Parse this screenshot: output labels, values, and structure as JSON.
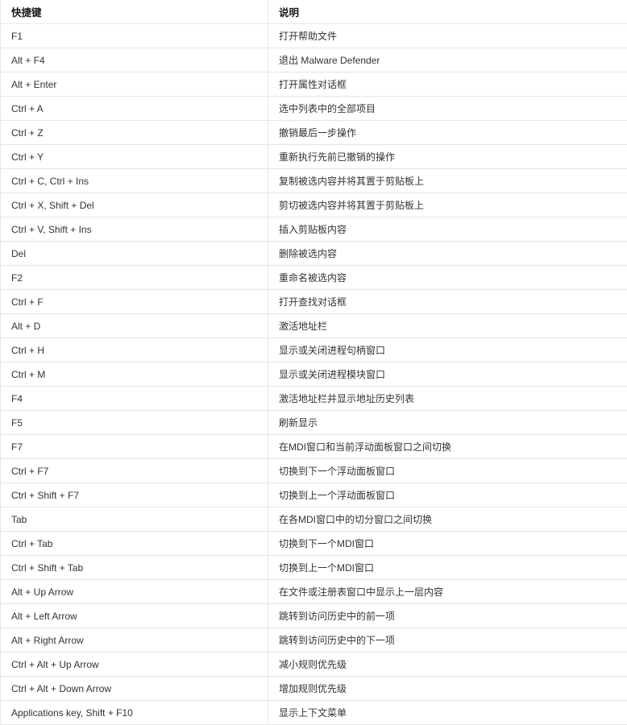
{
  "table": {
    "columns": [
      {
        "key": "shortcut",
        "label": "快捷键"
      },
      {
        "key": "description",
        "label": "说明"
      }
    ],
    "rows": [
      {
        "shortcut": "F1",
        "description": "打开帮助文件"
      },
      {
        "shortcut": "Alt + F4",
        "description": "退出 Malware Defender"
      },
      {
        "shortcut": "Alt + Enter",
        "description": "打开属性对话框"
      },
      {
        "shortcut": "Ctrl + A",
        "description": "选中列表中的全部项目"
      },
      {
        "shortcut": "Ctrl + Z",
        "description": "撤销最后一步操作"
      },
      {
        "shortcut": "Ctrl + Y",
        "description": "重新执行先前已撤销的操作"
      },
      {
        "shortcut": "Ctrl + C, Ctrl + Ins",
        "description": "复制被选内容并将其置于剪贴板上"
      },
      {
        "shortcut": "Ctrl + X, Shift + Del",
        "description": "剪切被选内容并将其置于剪贴板上"
      },
      {
        "shortcut": "Ctrl + V, Shift + Ins",
        "description": "插入剪贴板内容"
      },
      {
        "shortcut": "Del",
        "description": "删除被选内容"
      },
      {
        "shortcut": "F2",
        "description": "重命名被选内容"
      },
      {
        "shortcut": "Ctrl + F",
        "description": "打开查找对话框"
      },
      {
        "shortcut": "Alt + D",
        "description": "激活地址栏"
      },
      {
        "shortcut": "Ctrl + H",
        "description": "显示或关闭进程句柄窗口"
      },
      {
        "shortcut": "Ctrl + M",
        "description": "显示或关闭进程模块窗口"
      },
      {
        "shortcut": "F4",
        "description": "激活地址栏并显示地址历史列表"
      },
      {
        "shortcut": "F5",
        "description": "刷新显示"
      },
      {
        "shortcut": "F7",
        "description": "在MDI窗口和当前浮动面板窗口之间切换"
      },
      {
        "shortcut": "Ctrl + F7",
        "description": "切换到下一个浮动面板窗口"
      },
      {
        "shortcut": "Ctrl + Shift + F7",
        "description": "切换到上一个浮动面板窗口"
      },
      {
        "shortcut": "Tab",
        "description": "在各MDI窗口中的切分窗口之间切换"
      },
      {
        "shortcut": "Ctrl + Tab",
        "description": "切换到下一个MDI窗口"
      },
      {
        "shortcut": "Ctrl + Shift + Tab",
        "description": "切换到上一个MDI窗口"
      },
      {
        "shortcut": "Alt + Up Arrow",
        "description": "在文件或注册表窗口中显示上一层内容"
      },
      {
        "shortcut": "Alt + Left Arrow",
        "description": "跳转到访问历史中的前一项"
      },
      {
        "shortcut": "Alt + Right Arrow",
        "description": "跳转到访问历史中的下一项"
      },
      {
        "shortcut": "Ctrl + Alt + Up Arrow",
        "description": "减小规则优先级"
      },
      {
        "shortcut": "Ctrl + Alt + Down Arrow",
        "description": "增加规则优先级"
      },
      {
        "shortcut": "Applications key, Shift + F10",
        "description": "显示上下文菜单"
      }
    ]
  },
  "colors": {
    "text": "#333333",
    "header_text": "#1a1a1a",
    "border": "#e6e6e6",
    "background": "#ffffff"
  }
}
